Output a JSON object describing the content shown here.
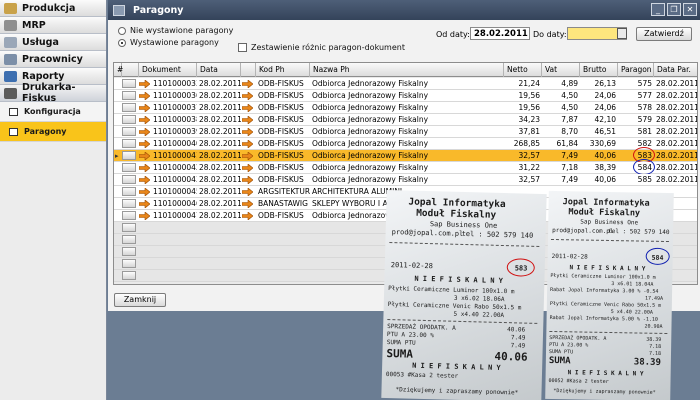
{
  "sidebar": {
    "items": [
      {
        "label": "Produkcja",
        "icon": "production-icon",
        "color": "#c9a24a"
      },
      {
        "label": "MRP",
        "icon": "mrp-icon",
        "color": "#8f8f8f"
      },
      {
        "label": "Usługa",
        "icon": "service-icon",
        "color": "#9aa7b8"
      },
      {
        "label": "Pracownicy",
        "icon": "employees-icon",
        "color": "#7c8fa8"
      },
      {
        "label": "Raporty",
        "icon": "reports-icon",
        "color": "#3d6fb0"
      },
      {
        "label": "Drukarka-Fiskus",
        "icon": "fiscal-printer-icon",
        "color": "#5b5b5b"
      }
    ],
    "subitems": [
      {
        "label": "Konfiguracja",
        "icon": "config-icon"
      },
      {
        "label": "Paragony",
        "icon": "receipts-icon"
      }
    ]
  },
  "window": {
    "title": "Paragony",
    "filters": {
      "radio_not_issued": "Nie wystawione paragony",
      "radio_issued": "Wystawione paragony",
      "checkbox_diff": "Zestawienie różnic paragon-dokument",
      "date_from_label": "Od daty:",
      "date_from_value": "28.02.2011",
      "date_to_label": "Do daty:",
      "date_to_value": "",
      "change_button": "Zatwierdź"
    },
    "close_button": "Zamknij"
  },
  "table": {
    "headers": [
      "#",
      "",
      "Dokument",
      "Data",
      "",
      "Kod Ph",
      "Nazwa Ph",
      "Netto",
      "Vat",
      "Brutto",
      "Paragon",
      "Data Par."
    ],
    "rows": [
      {
        "doc": "1101000033",
        "date": "28.02.2011",
        "code": "ODB-FISKUS",
        "name": "Odbiorca Jednorazowy Fiskalny",
        "net": "21,24",
        "vat": "4,89",
        "gross": "26,13",
        "receipt": "575",
        "rdate": "28.02.2011"
      },
      {
        "doc": "1101000036",
        "date": "28.02.2011",
        "code": "ODB-FISKUS",
        "name": "Odbiorca Jednorazowy Fiskalny",
        "net": "19,56",
        "vat": "4,50",
        "gross": "24,06",
        "receipt": "577",
        "rdate": "28.02.2011"
      },
      {
        "doc": "1101000037",
        "date": "28.02.2011",
        "code": "ODB-FISKUS",
        "name": "Odbiorca Jednorazowy Fiskalny",
        "net": "19,56",
        "vat": "4,50",
        "gross": "24,06",
        "receipt": "578",
        "rdate": "28.02.2011"
      },
      {
        "doc": "1101000038",
        "date": "28.02.2011",
        "code": "ODB-FISKUS",
        "name": "Odbiorca Jednorazowy Fiskalny",
        "net": "34,23",
        "vat": "7,87",
        "gross": "42,10",
        "receipt": "579",
        "rdate": "28.02.2011"
      },
      {
        "doc": "1101000039",
        "date": "28.02.2011",
        "code": "ODB-FISKUS",
        "name": "Odbiorca Jednorazowy Fiskalny",
        "net": "37,81",
        "vat": "8,70",
        "gross": "46,51",
        "receipt": "581",
        "rdate": "28.02.2011"
      },
      {
        "doc": "1101000040",
        "date": "28.02.2011",
        "code": "ODB-FISKUS",
        "name": "Odbiorca Jednorazowy Fiskalny",
        "net": "268,85",
        "vat": "61,84",
        "gross": "330,69",
        "receipt": "582",
        "rdate": "28.02.2011"
      },
      {
        "doc": "1101000041",
        "date": "28.02.2011",
        "code": "ODB-FISKUS",
        "name": "Odbiorca Jednorazowy Fiskalny",
        "net": "32,57",
        "vat": "7,49",
        "gross": "40,06",
        "receipt": "583",
        "rdate": "28.02.2011"
      },
      {
        "doc": "1101000042",
        "date": "28.02.2011",
        "code": "ODB-FISKUS",
        "name": "Odbiorca Jednorazowy Fiskalny",
        "net": "31,22",
        "vat": "7,18",
        "gross": "38,39",
        "receipt": "584",
        "rdate": "28.02.2011"
      },
      {
        "doc": "1101000043",
        "date": "28.02.2011",
        "code": "ODB-FISKUS",
        "name": "Odbiorca Jednorazowy Fiskalny",
        "net": "32,57",
        "vat": "7,49",
        "gross": "40,06",
        "receipt": "585",
        "rdate": "28.02.2011"
      },
      {
        "doc": "1101000045",
        "date": "28.02.2011",
        "code": "ARGSITEKTUR",
        "name": "ARCHITEKTURA ALUMINI",
        "net": "",
        "vat": "",
        "gross": "",
        "receipt": "",
        "rdate": ""
      },
      {
        "doc": "1101000046",
        "date": "28.02.2011",
        "code": "BANASTAWIG",
        "name": "SKLEPY WYBORU I ASOR",
        "net": "",
        "vat": "",
        "gross": "",
        "receipt": "",
        "rdate": ""
      },
      {
        "doc": "1101000047",
        "date": "28.02.2011",
        "code": "ODB-FISKUS",
        "name": "Odbiorca Jednorazowy Fiskalny",
        "net": "",
        "vat": "",
        "gross": "",
        "receipt": "",
        "rdate": ""
      }
    ],
    "selected_index": 6
  },
  "receipt_left": {
    "l1": "Jopal Informatyka",
    "l2": "Moduł Fiskalny",
    "l3": "Sap Business One",
    "l4": "prod@jopal.com.pl",
    "l5": "tel : 502 579 140",
    "date": "2011-02-28",
    "number": "583",
    "nf": "N I E F I S K A L N Y",
    "p1": "Płytki Ceramiczne Luminor 100x1.0 m",
    "p2": "3 x6.02 18.06A",
    "p3": "Płytki Ceramiczne Venic Rabo 50x1.5 m",
    "p4": "5 x4.40 22.00A",
    "s1": "SPRZEDAŻ OPODATK. A",
    "s1v": "40.06",
    "s2": "PTU A 23.00 %",
    "s2v": "7.49",
    "s3": "SUMA PTU",
    "s3v": "7.49",
    "total_lbl": "SUMA",
    "total": "40.06",
    "nf2": "N I E F I S K A L N Y",
    "f1": "00053 #Kasa 2  tester",
    "f2": "*Dziękujemy i zapraszamy ponownie*"
  },
  "receipt_right": {
    "l1": "Jopal Informatyka",
    "l2": "Moduł Fiskalny",
    "l3": "Sap Business One",
    "l4": "prod@jopal.com.pl",
    "l5": "tel : 502 579 140",
    "date": "2011-02-28",
    "number": "584",
    "nf": "N I E F I S K A L N Y",
    "p1": "Płytki Ceramiczne Luminor 100x1.0 m",
    "p2": "3 x6.01 18.04A",
    "p3": "Rabat Jopal Informatyka 3.00 % -0.54",
    "p4": "17.49A",
    "p5": "Płytki Ceramiczne Venic Rabo 50x1.5 m",
    "p6": "5 x4.40 22.00A",
    "p7": "Rabat Jopal Informatyka 5.00 % -1.10",
    "p8": "20.90A",
    "s1": "SPRZEDAŻ OPODATK. A",
    "s1v": "38.39",
    "s2": "PTU A 23.00 %",
    "s2v": "7.18",
    "s3": "SUMA PTU",
    "s3v": "7.18",
    "total_lbl": "SUMA",
    "total": "38.39",
    "nf2": "N I E F I S K A L N Y",
    "f1": "00052 #Kasa 2  tester",
    "f2": "*Dziękujemy i zapraszamy ponownie*"
  }
}
